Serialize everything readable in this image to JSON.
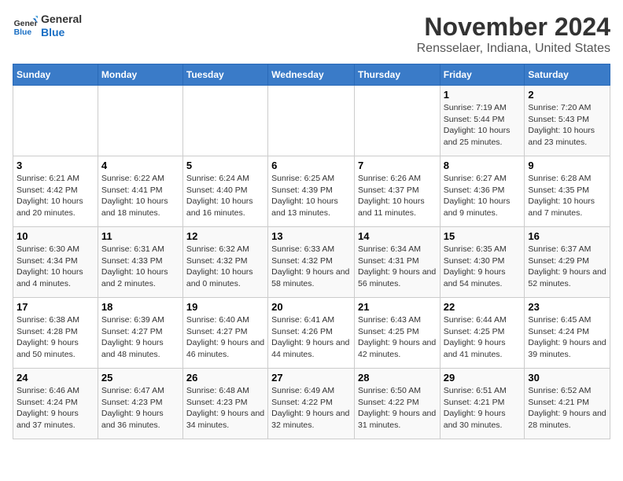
{
  "header": {
    "logo_general": "General",
    "logo_blue": "Blue",
    "title": "November 2024",
    "subtitle": "Rensselaer, Indiana, United States"
  },
  "days_of_week": [
    "Sunday",
    "Monday",
    "Tuesday",
    "Wednesday",
    "Thursday",
    "Friday",
    "Saturday"
  ],
  "weeks": [
    [
      {
        "day": "",
        "info": ""
      },
      {
        "day": "",
        "info": ""
      },
      {
        "day": "",
        "info": ""
      },
      {
        "day": "",
        "info": ""
      },
      {
        "day": "",
        "info": ""
      },
      {
        "day": "1",
        "info": "Sunrise: 7:19 AM\nSunset: 5:44 PM\nDaylight: 10 hours and 25 minutes."
      },
      {
        "day": "2",
        "info": "Sunrise: 7:20 AM\nSunset: 5:43 PM\nDaylight: 10 hours and 23 minutes."
      }
    ],
    [
      {
        "day": "3",
        "info": "Sunrise: 6:21 AM\nSunset: 4:42 PM\nDaylight: 10 hours and 20 minutes."
      },
      {
        "day": "4",
        "info": "Sunrise: 6:22 AM\nSunset: 4:41 PM\nDaylight: 10 hours and 18 minutes."
      },
      {
        "day": "5",
        "info": "Sunrise: 6:24 AM\nSunset: 4:40 PM\nDaylight: 10 hours and 16 minutes."
      },
      {
        "day": "6",
        "info": "Sunrise: 6:25 AM\nSunset: 4:39 PM\nDaylight: 10 hours and 13 minutes."
      },
      {
        "day": "7",
        "info": "Sunrise: 6:26 AM\nSunset: 4:37 PM\nDaylight: 10 hours and 11 minutes."
      },
      {
        "day": "8",
        "info": "Sunrise: 6:27 AM\nSunset: 4:36 PM\nDaylight: 10 hours and 9 minutes."
      },
      {
        "day": "9",
        "info": "Sunrise: 6:28 AM\nSunset: 4:35 PM\nDaylight: 10 hours and 7 minutes."
      }
    ],
    [
      {
        "day": "10",
        "info": "Sunrise: 6:30 AM\nSunset: 4:34 PM\nDaylight: 10 hours and 4 minutes."
      },
      {
        "day": "11",
        "info": "Sunrise: 6:31 AM\nSunset: 4:33 PM\nDaylight: 10 hours and 2 minutes."
      },
      {
        "day": "12",
        "info": "Sunrise: 6:32 AM\nSunset: 4:32 PM\nDaylight: 10 hours and 0 minutes."
      },
      {
        "day": "13",
        "info": "Sunrise: 6:33 AM\nSunset: 4:32 PM\nDaylight: 9 hours and 58 minutes."
      },
      {
        "day": "14",
        "info": "Sunrise: 6:34 AM\nSunset: 4:31 PM\nDaylight: 9 hours and 56 minutes."
      },
      {
        "day": "15",
        "info": "Sunrise: 6:35 AM\nSunset: 4:30 PM\nDaylight: 9 hours and 54 minutes."
      },
      {
        "day": "16",
        "info": "Sunrise: 6:37 AM\nSunset: 4:29 PM\nDaylight: 9 hours and 52 minutes."
      }
    ],
    [
      {
        "day": "17",
        "info": "Sunrise: 6:38 AM\nSunset: 4:28 PM\nDaylight: 9 hours and 50 minutes."
      },
      {
        "day": "18",
        "info": "Sunrise: 6:39 AM\nSunset: 4:27 PM\nDaylight: 9 hours and 48 minutes."
      },
      {
        "day": "19",
        "info": "Sunrise: 6:40 AM\nSunset: 4:27 PM\nDaylight: 9 hours and 46 minutes."
      },
      {
        "day": "20",
        "info": "Sunrise: 6:41 AM\nSunset: 4:26 PM\nDaylight: 9 hours and 44 minutes."
      },
      {
        "day": "21",
        "info": "Sunrise: 6:43 AM\nSunset: 4:25 PM\nDaylight: 9 hours and 42 minutes."
      },
      {
        "day": "22",
        "info": "Sunrise: 6:44 AM\nSunset: 4:25 PM\nDaylight: 9 hours and 41 minutes."
      },
      {
        "day": "23",
        "info": "Sunrise: 6:45 AM\nSunset: 4:24 PM\nDaylight: 9 hours and 39 minutes."
      }
    ],
    [
      {
        "day": "24",
        "info": "Sunrise: 6:46 AM\nSunset: 4:24 PM\nDaylight: 9 hours and 37 minutes."
      },
      {
        "day": "25",
        "info": "Sunrise: 6:47 AM\nSunset: 4:23 PM\nDaylight: 9 hours and 36 minutes."
      },
      {
        "day": "26",
        "info": "Sunrise: 6:48 AM\nSunset: 4:23 PM\nDaylight: 9 hours and 34 minutes."
      },
      {
        "day": "27",
        "info": "Sunrise: 6:49 AM\nSunset: 4:22 PM\nDaylight: 9 hours and 32 minutes."
      },
      {
        "day": "28",
        "info": "Sunrise: 6:50 AM\nSunset: 4:22 PM\nDaylight: 9 hours and 31 minutes."
      },
      {
        "day": "29",
        "info": "Sunrise: 6:51 AM\nSunset: 4:21 PM\nDaylight: 9 hours and 30 minutes."
      },
      {
        "day": "30",
        "info": "Sunrise: 6:52 AM\nSunset: 4:21 PM\nDaylight: 9 hours and 28 minutes."
      }
    ]
  ]
}
